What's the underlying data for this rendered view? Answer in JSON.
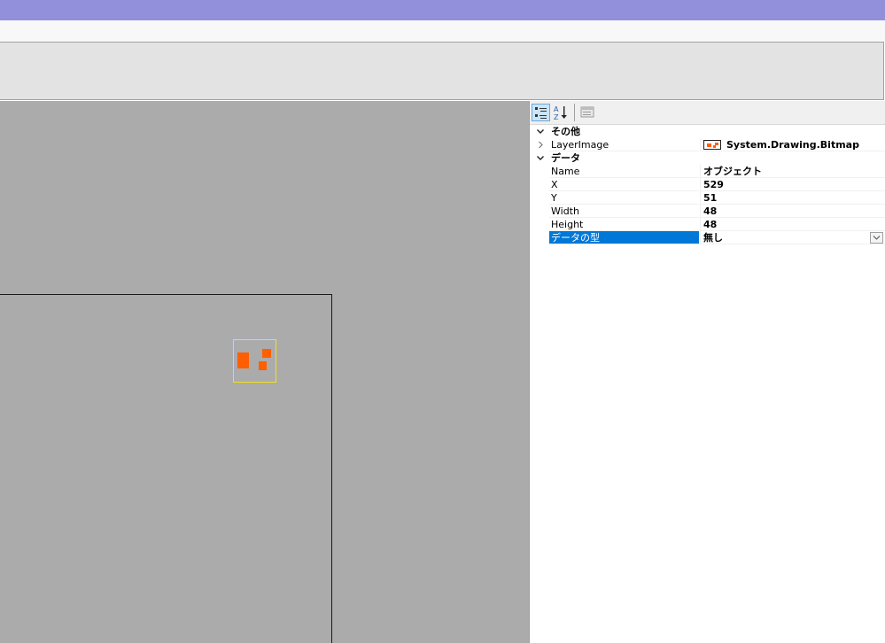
{
  "window": {
    "titlebar_color": "#9290db"
  },
  "canvas": {
    "background": "#ababab",
    "sprite_color": "#ff5f00",
    "selection_color": "#f2e21a"
  },
  "propgrid": {
    "toolbar": {
      "categorized_icon": "categorized-icon",
      "alphabetical_icon": "sort-alphabetical-icon",
      "pages_icon": "property-pages-icon"
    },
    "categories": [
      {
        "label": "その他",
        "expanded": true,
        "properties": [
          {
            "name": "LayerImage",
            "value": "System.Drawing.Bitmap",
            "expandable": true,
            "has_thumbnail": true
          }
        ]
      },
      {
        "label": "データ",
        "expanded": true,
        "properties": [
          {
            "name": "Name",
            "value": "オブジェクト"
          },
          {
            "name": "X",
            "value": "529"
          },
          {
            "name": "Y",
            "value": "51"
          },
          {
            "name": "Width",
            "value": "48"
          },
          {
            "name": "Height",
            "value": "48"
          },
          {
            "name": "データの型",
            "value": "無し",
            "selected": true,
            "has_dropdown": true
          }
        ]
      }
    ],
    "selection_color": "#0078d7"
  }
}
